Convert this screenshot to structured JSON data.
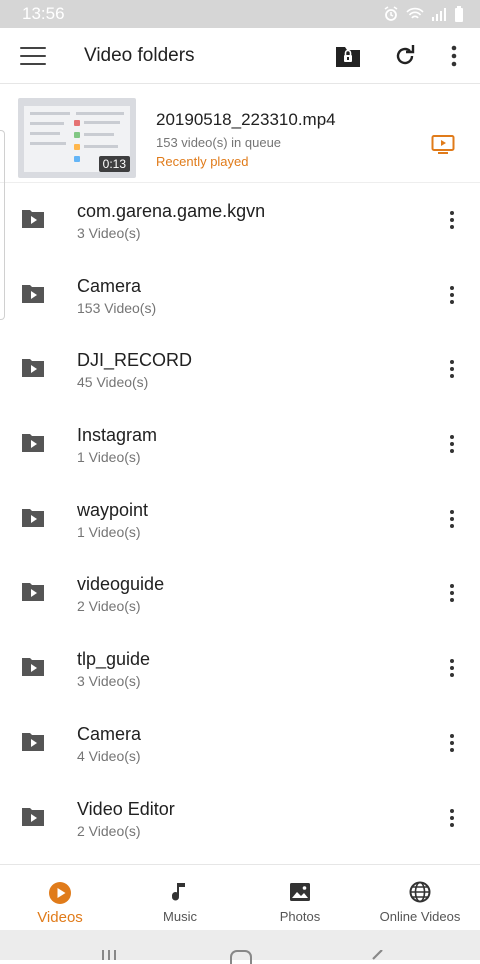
{
  "status_bar": {
    "time": "13:56"
  },
  "app_bar": {
    "title": "Video folders"
  },
  "recent": {
    "title": "20190518_223310.mp4",
    "subtitle": "153 video(s) in queue",
    "status": "Recently played",
    "duration": "0:13"
  },
  "folders": [
    {
      "name": "com.garena.game.kgvn",
      "count": "3 Video(s)"
    },
    {
      "name": "Camera",
      "count": "153 Video(s)"
    },
    {
      "name": "DJI_RECORD",
      "count": "45 Video(s)"
    },
    {
      "name": "Instagram",
      "count": "1 Video(s)"
    },
    {
      "name": "waypoint",
      "count": "1 Video(s)"
    },
    {
      "name": "videoguide",
      "count": "2 Video(s)"
    },
    {
      "name": "tlp_guide",
      "count": "3 Video(s)"
    },
    {
      "name": "Camera",
      "count": "4 Video(s)"
    },
    {
      "name": "Video Editor",
      "count": "2 Video(s)"
    }
  ],
  "bottom_nav": [
    {
      "label": "Videos",
      "icon": "play-circle-icon",
      "active": true
    },
    {
      "label": "Music",
      "icon": "music-note-icon",
      "active": false
    },
    {
      "label": "Photos",
      "icon": "photo-icon",
      "active": false
    },
    {
      "label": "Online Videos",
      "icon": "globe-icon",
      "active": false
    }
  ],
  "colors": {
    "accent": "#e07b1a",
    "status_bar": "#d6d6d6",
    "text_primary": "#212121",
    "text_secondary": "#757575"
  }
}
